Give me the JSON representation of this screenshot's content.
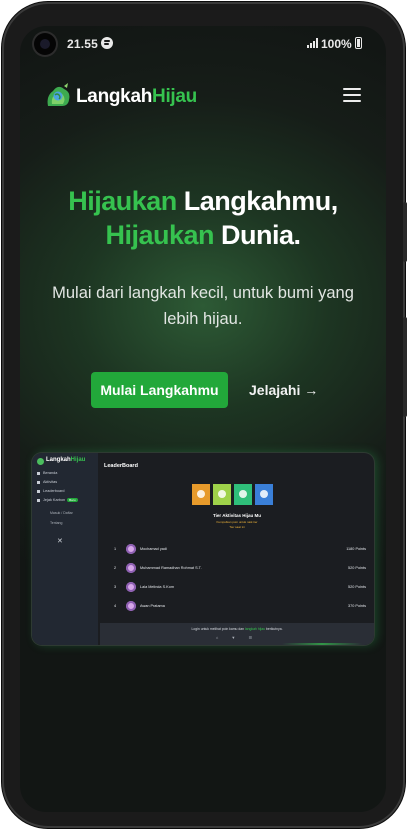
{
  "status_bar": {
    "time": "21.55",
    "battery": "100%"
  },
  "header": {
    "brand_part1": "Langkah",
    "brand_part2": "Hijau"
  },
  "hero": {
    "title_l1_green": "Hijaukan",
    "title_l1_white": " Langkahmu,",
    "title_l2_green": "Hijaukan",
    "title_l2_white": " Dunia.",
    "subtitle": "Mulai dari langkah kecil, untuk bumi yang lebih hijau.",
    "cta_label": "Mulai Langkahmu",
    "explore_label": "Jelajahi →"
  },
  "preview": {
    "brand_part1": "Langkah",
    "brand_part2": "Hijau",
    "nav": [
      "Beranda",
      "Aktivitas",
      "Leaderboard",
      "Jejak Karbon"
    ],
    "nav_badge": "Baru",
    "sub_nav": [
      "Masuk / Daftar",
      "Tentang"
    ],
    "title": "LeaderBoard",
    "heading": "Tier Aktivitas Hijau Mu",
    "caption": "Kumpulkan poin untuk naik tier",
    "caption2": "Tier saat ini",
    "rows": [
      {
        "rank": "1",
        "name": "Mochamad yadi",
        "points": "1180 Points"
      },
      {
        "rank": "2",
        "name": "Muhammad Ramadhan Rohmat S.T.",
        "points": "520 Points"
      },
      {
        "rank": "3",
        "name": "Lala Melinda S.Kom",
        "points": "520 Points"
      },
      {
        "rank": "4",
        "name": "Awan Pratama",
        "points": "370 Points"
      }
    ],
    "footer_text_a": "Login untuk melihat poin kamu dan",
    "footer_text_green": "langkah hijau",
    "footer_text_b": "berikutnya.",
    "footer_icons": "⌂ ▼ ☰"
  },
  "colors": {
    "accent": "#36c24f",
    "button": "#22a83a"
  }
}
